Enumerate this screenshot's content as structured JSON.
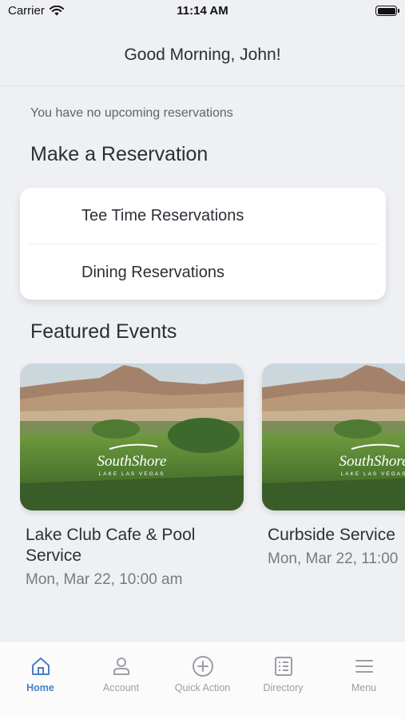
{
  "status_bar": {
    "carrier": "Carrier",
    "time": "11:14 AM"
  },
  "header": {
    "greeting": "Good Morning, John!"
  },
  "reservations": {
    "empty_text": "You have no upcoming reservations",
    "section_title": "Make a Reservation",
    "items": [
      {
        "label": "Tee Time Reservations"
      },
      {
        "label": "Dining Reservations"
      }
    ]
  },
  "events": {
    "section_title": "Featured Events",
    "logo_text": "SouthShore",
    "logo_subtext": "LAKE LAS VEGAS",
    "items": [
      {
        "name": "Lake Club Cafe & Pool Service",
        "date": "Mon, Mar 22, 10:00 am"
      },
      {
        "name": "Curbside Service",
        "date": "Mon, Mar 22, 11:00"
      }
    ]
  },
  "tab_bar": {
    "tabs": [
      {
        "label": "Home",
        "icon": "home-icon",
        "active": true
      },
      {
        "label": "Account",
        "icon": "account-icon",
        "active": false
      },
      {
        "label": "Quick Action",
        "icon": "plus-circle-icon",
        "active": false
      },
      {
        "label": "Directory",
        "icon": "directory-icon",
        "active": false
      },
      {
        "label": "Menu",
        "icon": "menu-icon",
        "active": false
      }
    ]
  },
  "colors": {
    "accent": "#4a7fc4",
    "background": "#eef0f3",
    "inactive": "#9a9ea5"
  }
}
